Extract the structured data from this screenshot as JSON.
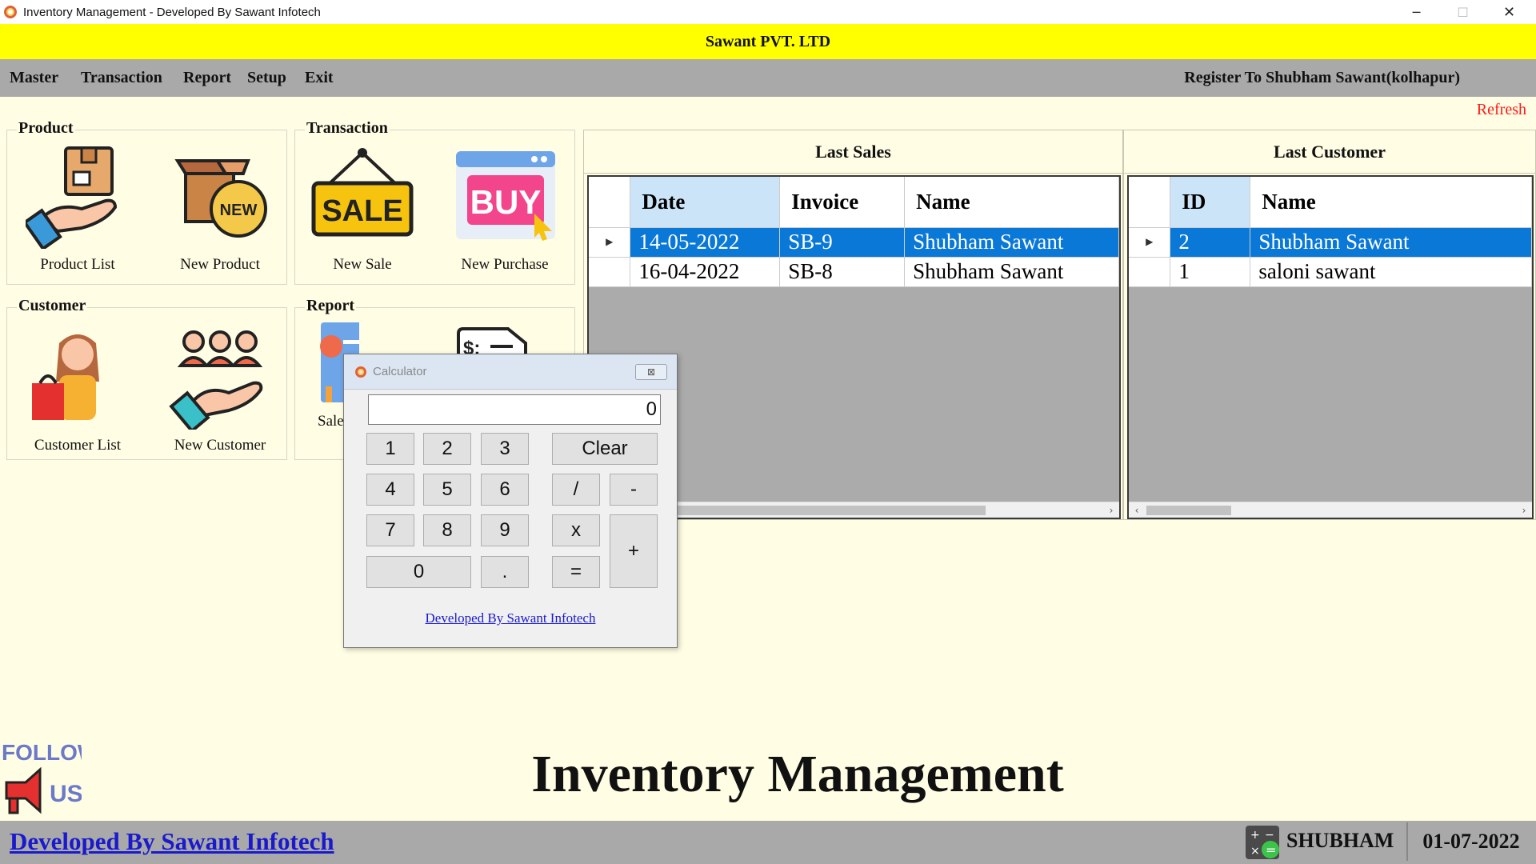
{
  "window": {
    "title": "Inventory Management - Developed By Sawant Infotech",
    "min_glyph": "─",
    "max_glyph": "☐",
    "close_glyph": "✕"
  },
  "banner": {
    "company": "Sawant PVT. LTD"
  },
  "menu": {
    "items": [
      "Master",
      "Transaction",
      "Report",
      "Setup",
      "Exit"
    ],
    "register": "Register To Shubham Sawant(kolhapur)"
  },
  "refresh_label": "Refresh",
  "groups": {
    "product": {
      "title": "Product",
      "tiles": [
        "Product List",
        "New Product"
      ]
    },
    "transaction": {
      "title": "Transaction",
      "tiles": [
        "New Sale",
        "New Purchase"
      ]
    },
    "customer": {
      "title": "Customer",
      "tiles": [
        "Customer List",
        "New Customer"
      ]
    },
    "report": {
      "title": "Report",
      "tiles": [
        "Sale"
      ]
    }
  },
  "icons": {
    "sale_text": "SALE",
    "buy_text": "BUY",
    "new_text": "NEW",
    "follow_text": "FOLLOW",
    "us_text": "US",
    "bill_text": "$:"
  },
  "last_sales": {
    "title": "Last Sales",
    "columns": [
      "Date",
      "Invoice",
      "Name"
    ],
    "rows": [
      {
        "date": "14-05-2022",
        "invoice": "SB-9",
        "name": "Shubham Sawant"
      },
      {
        "date": "16-04-2022",
        "invoice": "SB-8",
        "name": "Shubham Sawant"
      }
    ]
  },
  "last_customer": {
    "title": "Last Customer",
    "columns": [
      "ID",
      "Name"
    ],
    "rows": [
      {
        "id": "2",
        "name": "Shubham Sawant"
      },
      {
        "id": "1",
        "name": "saloni sawant"
      }
    ]
  },
  "calculator": {
    "title": "Calculator",
    "display": "0",
    "buttons": {
      "b1": "1",
      "b2": "2",
      "b3": "3",
      "b4": "4",
      "b5": "5",
      "b6": "6",
      "b7": "7",
      "b8": "8",
      "b9": "9",
      "b0": "0",
      "dot": ".",
      "clear": "Clear",
      "div": "/",
      "sub": "-",
      "mul": "x",
      "eq": "=",
      "add": "+"
    },
    "link": "Developed By Sawant Infotech"
  },
  "main_title": "Inventory Management",
  "status": {
    "dev_link": "Developed By Sawant Infotech",
    "user": "SHUBHAM",
    "date": "01-07-2022"
  },
  "colors": {
    "banner": "#ffff00",
    "menubar": "#a9a9a9",
    "background": "#fffde3",
    "selection": "#0a78d7",
    "refresh": "#ff1a1a",
    "link": "#1a1acc"
  }
}
